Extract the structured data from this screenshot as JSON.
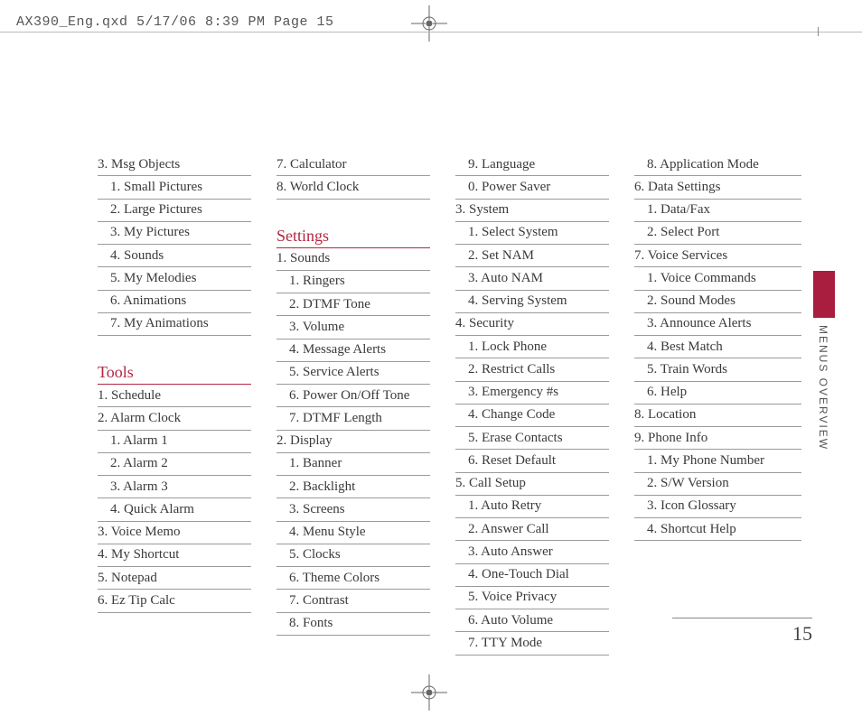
{
  "header": "AX390_Eng.qxd  5/17/06  8:39 PM  Page 15",
  "side_label": "MENUS OVERVIEW",
  "page_number": "15",
  "col1": {
    "items_a": [
      {
        "t": "3. Msg Objects",
        "i": 0
      },
      {
        "t": "1. Small Pictures",
        "i": 1
      },
      {
        "t": "2. Large Pictures",
        "i": 1
      },
      {
        "t": "3. My Pictures",
        "i": 1
      },
      {
        "t": "4. Sounds",
        "i": 1
      },
      {
        "t": "5. My Melodies",
        "i": 1
      },
      {
        "t": "6. Animations",
        "i": 1
      },
      {
        "t": "7. My Animations",
        "i": 1
      }
    ],
    "heading": "Tools",
    "items_b": [
      {
        "t": "1. Schedule",
        "i": 0
      },
      {
        "t": "2. Alarm Clock",
        "i": 0
      },
      {
        "t": "1. Alarm 1",
        "i": 1
      },
      {
        "t": "2. Alarm 2",
        "i": 1
      },
      {
        "t": "3. Alarm 3",
        "i": 1
      },
      {
        "t": "4. Quick Alarm",
        "i": 1
      },
      {
        "t": "3. Voice Memo",
        "i": 0
      },
      {
        "t": "4. My Shortcut",
        "i": 0
      },
      {
        "t": "5. Notepad",
        "i": 0
      },
      {
        "t": "6. Ez Tip Calc",
        "i": 0
      }
    ]
  },
  "col2": {
    "items_a": [
      {
        "t": "7. Calculator",
        "i": 0
      },
      {
        "t": "8. World Clock",
        "i": 0
      }
    ],
    "heading": "Settings",
    "items_b": [
      {
        "t": "1. Sounds",
        "i": 0
      },
      {
        "t": "1. Ringers",
        "i": 1
      },
      {
        "t": "2. DTMF Tone",
        "i": 1
      },
      {
        "t": "3. Volume",
        "i": 1
      },
      {
        "t": "4. Message Alerts",
        "i": 1
      },
      {
        "t": "5. Service Alerts",
        "i": 1
      },
      {
        "t": "6. Power On/Off Tone",
        "i": 1
      },
      {
        "t": "7. DTMF Length",
        "i": 1
      },
      {
        "t": "2. Display",
        "i": 0
      },
      {
        "t": "1. Banner",
        "i": 1
      },
      {
        "t": "2. Backlight",
        "i": 1
      },
      {
        "t": "3. Screens",
        "i": 1
      },
      {
        "t": "4. Menu Style",
        "i": 1
      },
      {
        "t": "5. Clocks",
        "i": 1
      },
      {
        "t": "6. Theme Colors",
        "i": 1
      },
      {
        "t": "7. Contrast",
        "i": 1
      },
      {
        "t": "8. Fonts",
        "i": 1
      }
    ]
  },
  "col3": {
    "items": [
      {
        "t": "9. Language",
        "i": 1
      },
      {
        "t": "0. Power Saver",
        "i": 1
      },
      {
        "t": "3. System",
        "i": 0
      },
      {
        "t": "1. Select System",
        "i": 1
      },
      {
        "t": "2. Set NAM",
        "i": 1
      },
      {
        "t": "3. Auto NAM",
        "i": 1
      },
      {
        "t": "4. Serving System",
        "i": 1
      },
      {
        "t": "4. Security",
        "i": 0
      },
      {
        "t": "1. Lock Phone",
        "i": 1
      },
      {
        "t": "2. Restrict Calls",
        "i": 1
      },
      {
        "t": "3. Emergency #s",
        "i": 1
      },
      {
        "t": "4. Change Code",
        "i": 1
      },
      {
        "t": "5. Erase Contacts",
        "i": 1
      },
      {
        "t": "6. Reset Default",
        "i": 1
      },
      {
        "t": "5. Call Setup",
        "i": 0
      },
      {
        "t": "1. Auto Retry",
        "i": 1
      },
      {
        "t": "2. Answer Call",
        "i": 1
      },
      {
        "t": "3. Auto Answer",
        "i": 1
      },
      {
        "t": "4. One-Touch Dial",
        "i": 1
      },
      {
        "t": "5. Voice Privacy",
        "i": 1
      },
      {
        "t": "6. Auto Volume",
        "i": 1
      },
      {
        "t": "7. TTY Mode",
        "i": 1
      }
    ]
  },
  "col4": {
    "items": [
      {
        "t": "8. Application Mode",
        "i": 1
      },
      {
        "t": "6. Data Settings",
        "i": 0
      },
      {
        "t": "1. Data/Fax",
        "i": 1
      },
      {
        "t": "2. Select Port",
        "i": 1
      },
      {
        "t": "7. Voice Services",
        "i": 0
      },
      {
        "t": "1. Voice Commands",
        "i": 1
      },
      {
        "t": "2. Sound Modes",
        "i": 1
      },
      {
        "t": "3. Announce Alerts",
        "i": 1
      },
      {
        "t": "4. Best Match",
        "i": 1
      },
      {
        "t": "5. Train Words",
        "i": 1
      },
      {
        "t": "6. Help",
        "i": 1
      },
      {
        "t": "8. Location",
        "i": 0
      },
      {
        "t": "9. Phone Info",
        "i": 0
      },
      {
        "t": "1. My Phone Number",
        "i": 1
      },
      {
        "t": "2. S/W Version",
        "i": 1
      },
      {
        "t": "3. Icon Glossary",
        "i": 1
      },
      {
        "t": "4. Shortcut Help",
        "i": 1
      }
    ]
  }
}
